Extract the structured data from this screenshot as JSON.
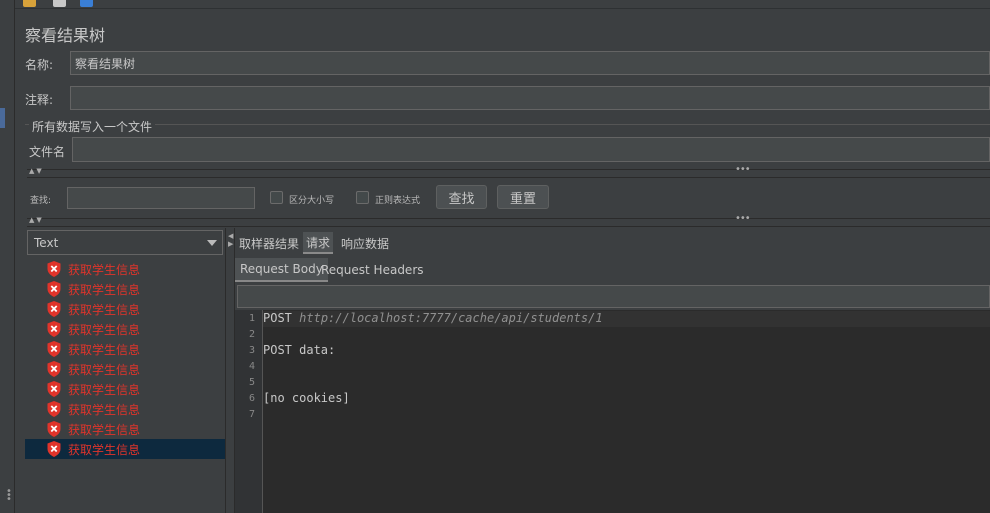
{
  "title": "察看结果树",
  "name_label": "名称:",
  "name_value": "察看结果树",
  "comment_label": "注释:",
  "comment_value": "",
  "file_group_title": "所有数据写入一个文件",
  "filename_label": "文件名",
  "filename_value": "",
  "search": {
    "label": "查找:",
    "value": "",
    "case_label": "区分大小写",
    "regex_label": "正则表达式",
    "find_button": "查找",
    "reset_button": "重置"
  },
  "renderer": {
    "selected": "Text"
  },
  "tree": {
    "items": [
      {
        "label": "获取学生信息",
        "status": "error"
      },
      {
        "label": "获取学生信息",
        "status": "error"
      },
      {
        "label": "获取学生信息",
        "status": "error"
      },
      {
        "label": "获取学生信息",
        "status": "error"
      },
      {
        "label": "获取学生信息",
        "status": "error"
      },
      {
        "label": "获取学生信息",
        "status": "error"
      },
      {
        "label": "获取学生信息",
        "status": "error"
      },
      {
        "label": "获取学生信息",
        "status": "error"
      },
      {
        "label": "获取学生信息",
        "status": "error"
      },
      {
        "label": "获取学生信息",
        "status": "error",
        "selected": true
      }
    ]
  },
  "tabs": [
    {
      "label": "取样器结果"
    },
    {
      "label": "请求",
      "active": true
    },
    {
      "label": "响应数据"
    }
  ],
  "subtabs": [
    {
      "label": "Request Body",
      "active": true
    },
    {
      "label": "Request Headers"
    }
  ],
  "editor": {
    "lines": [
      {
        "num": "1",
        "method": "POST",
        "url": "http://localhost:7777/cache/api/students/1"
      },
      {
        "num": "2",
        "text": ""
      },
      {
        "num": "3",
        "text": "POST data:"
      },
      {
        "num": "4",
        "text": ""
      },
      {
        "num": "5",
        "text": ""
      },
      {
        "num": "6",
        "text": "[no cookies]"
      },
      {
        "num": "7",
        "text": ""
      }
    ]
  },
  "colors": {
    "error_text": "#e0342b",
    "selection": "#0d293e",
    "background": "#3c3f41"
  },
  "icons": {
    "tree_item": "error-shield-icon",
    "combo": "chevron-down-icon"
  }
}
